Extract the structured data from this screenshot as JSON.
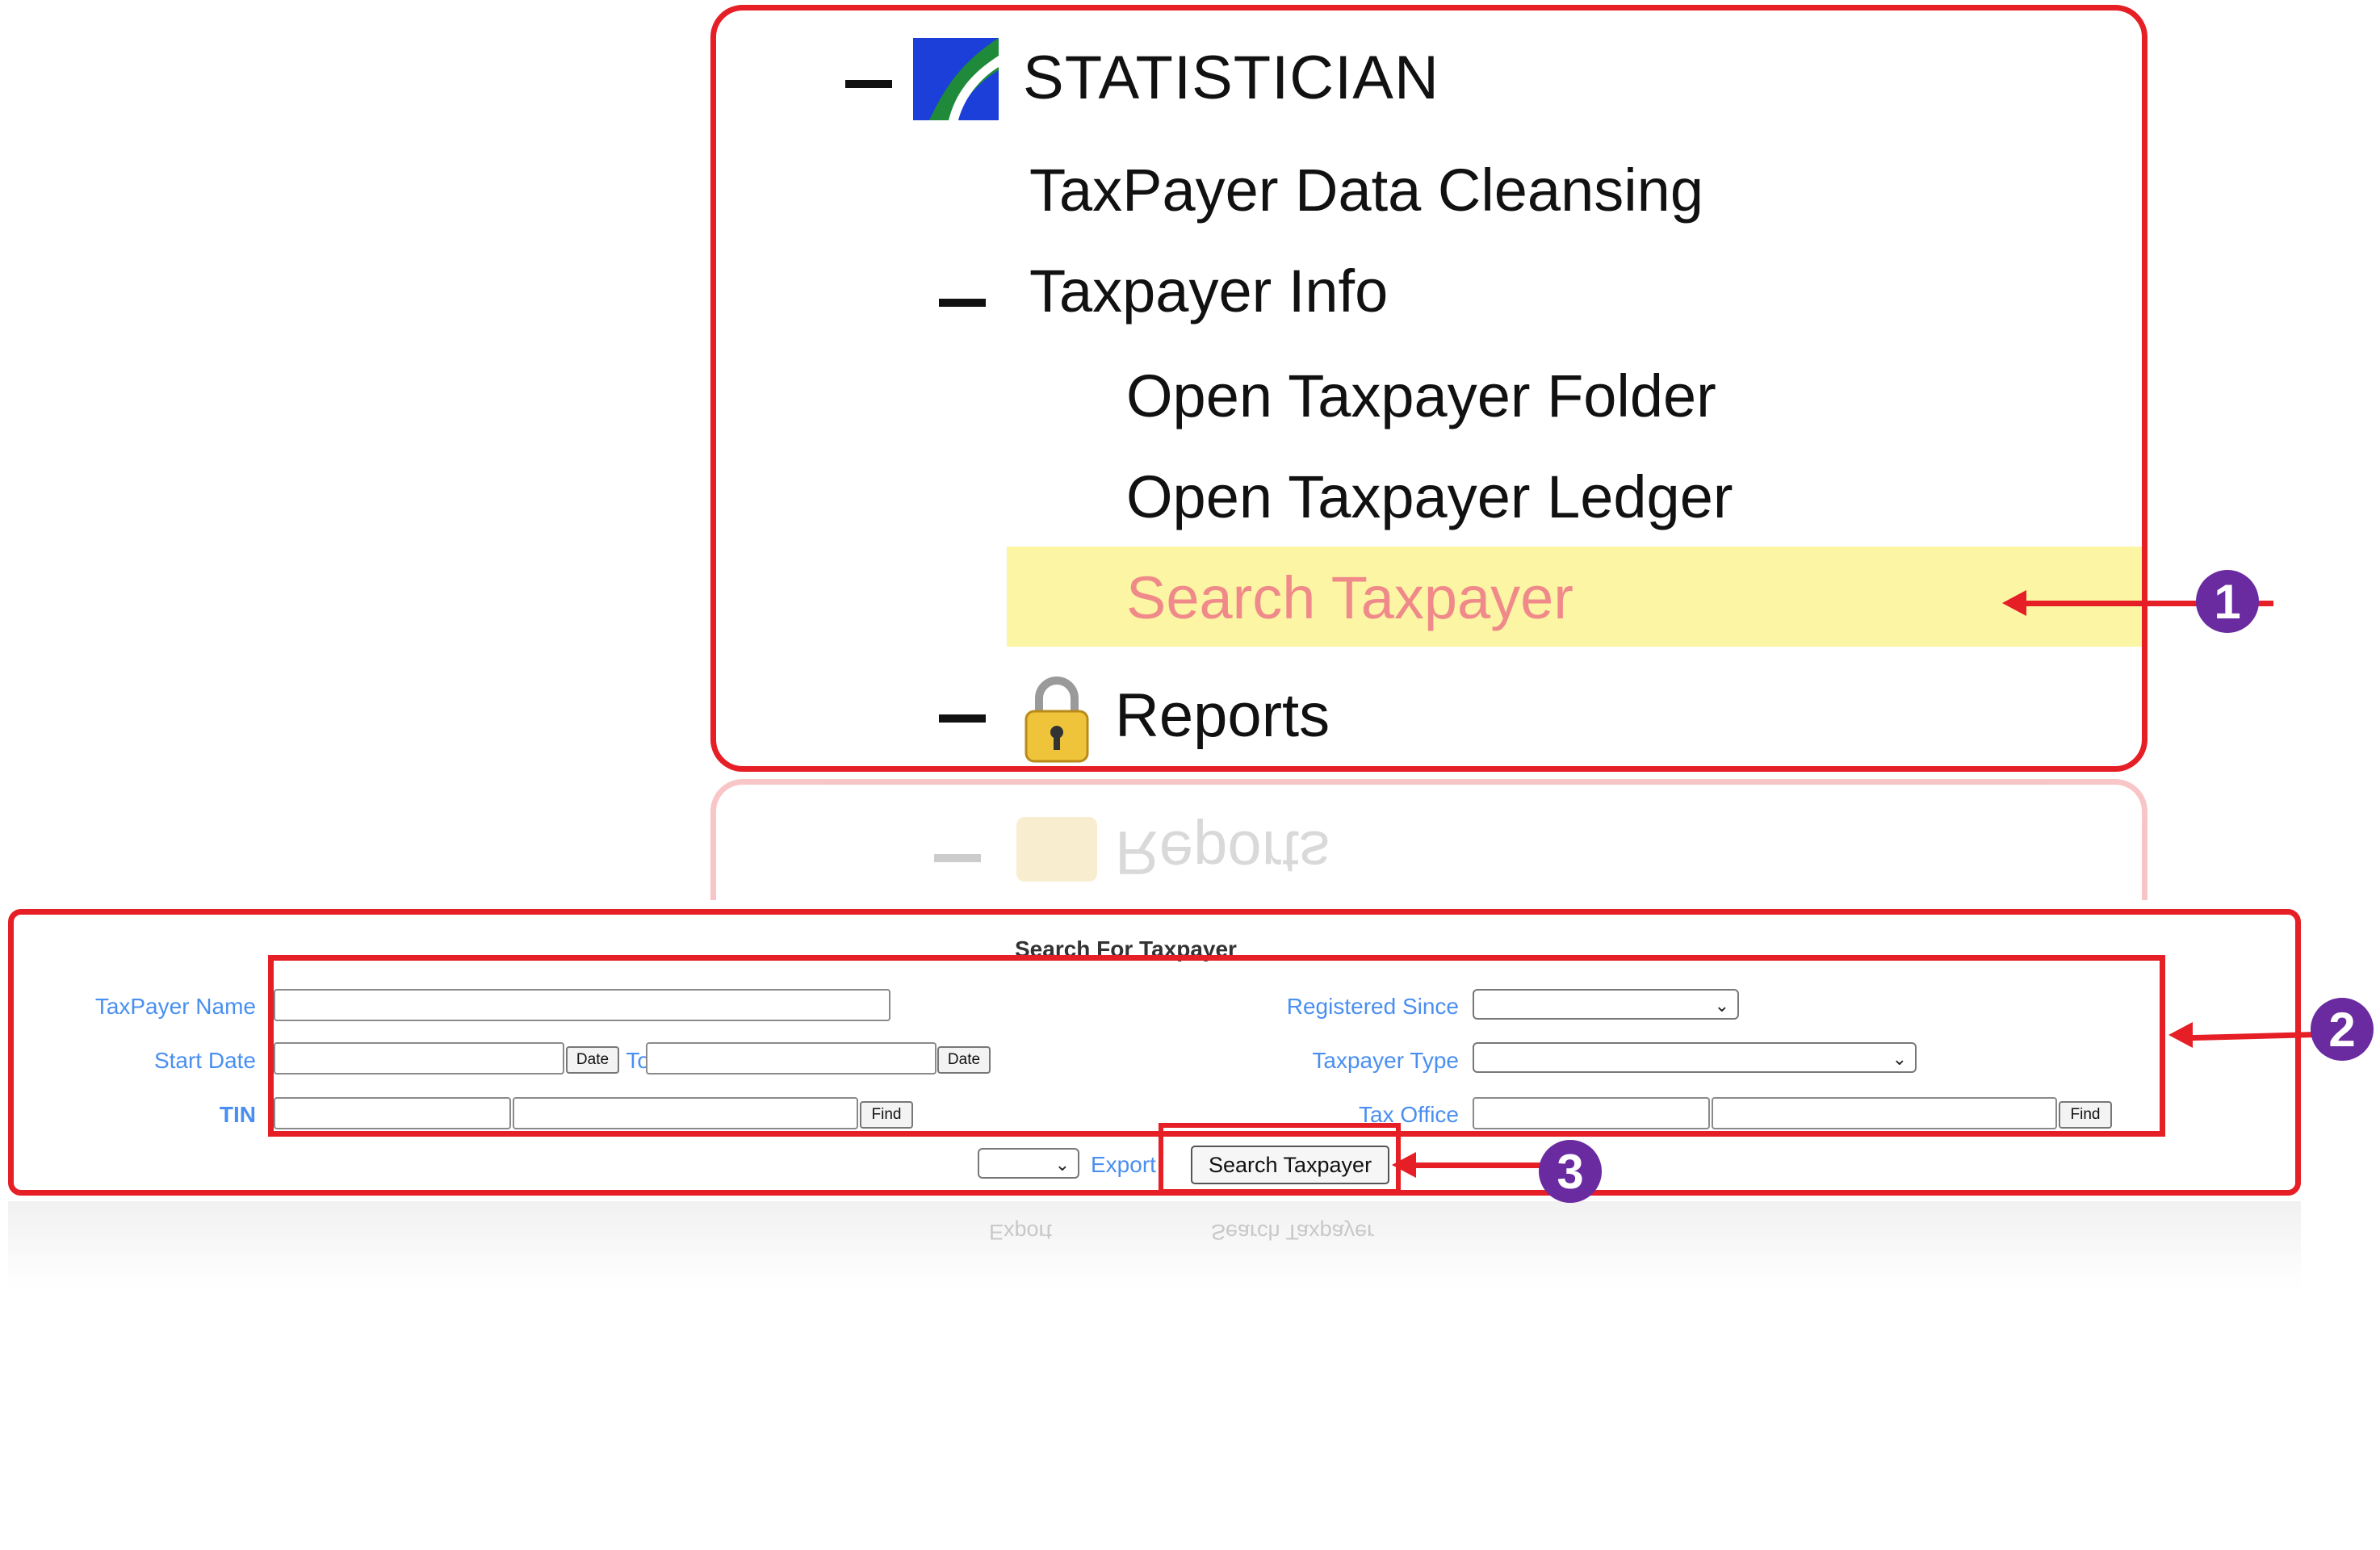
{
  "menu": {
    "statistician_label": "STATISTICIAN",
    "items": {
      "data_cleansing": "TaxPayer Data Cleansing",
      "taxpayer_info": "Taxpayer Info",
      "open_folder": "Open Taxpayer Folder",
      "open_ledger": "Open Taxpayer Ledger",
      "search_taxpayer": "Search Taxpayer",
      "reports": "Reports"
    },
    "highlight_color": "#fbf5a4",
    "active_text_color": "#f08a8a"
  },
  "form": {
    "title": "Search For Taxpayer",
    "labels": {
      "taxpayer_name": "TaxPayer Name",
      "start_date": "Start Date",
      "to": "To",
      "tin": "TIN",
      "registered_since": "Registered Since",
      "taxpayer_type": "Taxpayer Type",
      "tax_office": "Tax Office",
      "export": "Export"
    },
    "buttons": {
      "date": "Date",
      "find": "Find",
      "search": "Search Taxpayer"
    },
    "label_color": "#4a8ff0"
  },
  "callouts": [
    "1",
    "2",
    "3"
  ],
  "accent_color": "#e61e25",
  "badge_color": "#6a2aa0"
}
